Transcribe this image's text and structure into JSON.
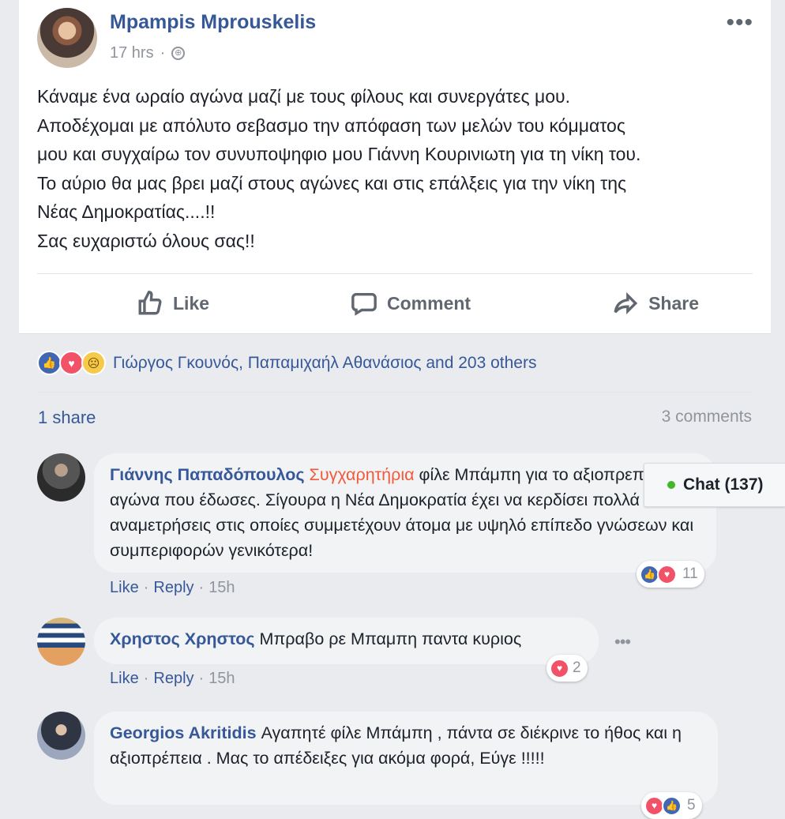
{
  "post": {
    "author": "Μpampis Mprouskelis",
    "time": "17 hrs",
    "separator": "·",
    "text_lines": [
      "Κάναμε ένα ωραίο αγώνα μαζί με τους φίλους και συνεργάτες μου.",
      "Αποδέχομαι με απόλυτο σεβασμο την απόφαση των μελών του κόμματος",
      "μου και συγχαίρω τον συνυποψηφιο μου Γιάννη Κουρινιωτη για τη νίκη του.",
      "Το αύριο θα μας βρει μαζί στους αγώνες και στις επάλξεις για την νίκη της",
      "Νέας Δημοκρατίας....!!",
      "Σας ευχαριστώ όλους σας!!"
    ]
  },
  "actions": {
    "like": "Like",
    "comment": "Comment",
    "share": "Share"
  },
  "reactions": {
    "names": "Γιώργος Γκουνός, Παπαμιχαήλ Αθανάσιος and 203 others"
  },
  "counts": {
    "shares": "1 share",
    "comments": "3 comments"
  },
  "comments": [
    {
      "author": "Γιάννης Παπαδόπουλος",
      "highlight": "Συγχαρητήρια",
      "text": "φίλε Μπάμπη για το αξιοπρεπή αγώνα που έδωσες. Σίγουρα η Νέα Δημοκρατία έχει να κερδίσει πολλά από αναμετρήσεις στις οποίες συμμετέχουν άτομα με υψηλό επίπεδο γνώσεων και συμπεριφορών γενικότερα!",
      "like": "Like",
      "reply": "Reply",
      "time": "15h",
      "reaction_count": "11"
    },
    {
      "author": "Χρηστος Χρηστος",
      "text": "Μπραβο ρε Μπαμπη παντα κυριος",
      "like": "Like",
      "reply": "Reply",
      "time": "15h",
      "reaction_count": "2"
    },
    {
      "author": "Georgios Akritidis",
      "text": "Αγαπητέ φίλε Μπάμπη , πάντα σε διέκρινε το ήθος και η αξιοπρέπεια . Μας το απέδειξες για ακόμα φορά, Εύγε !!!!!",
      "reaction_count": "5"
    }
  ],
  "chat": {
    "label": "Chat (137)"
  },
  "icons": [
    "globe-icon",
    "more-icon",
    "like-icon",
    "comment-icon",
    "share-icon",
    "like-reaction-icon",
    "love-reaction-icon",
    "sad-reaction-icon"
  ],
  "colors": {
    "link": "#365899",
    "meta": "#90949c",
    "highlight": "#f05a3b",
    "online": "#42b72a"
  }
}
